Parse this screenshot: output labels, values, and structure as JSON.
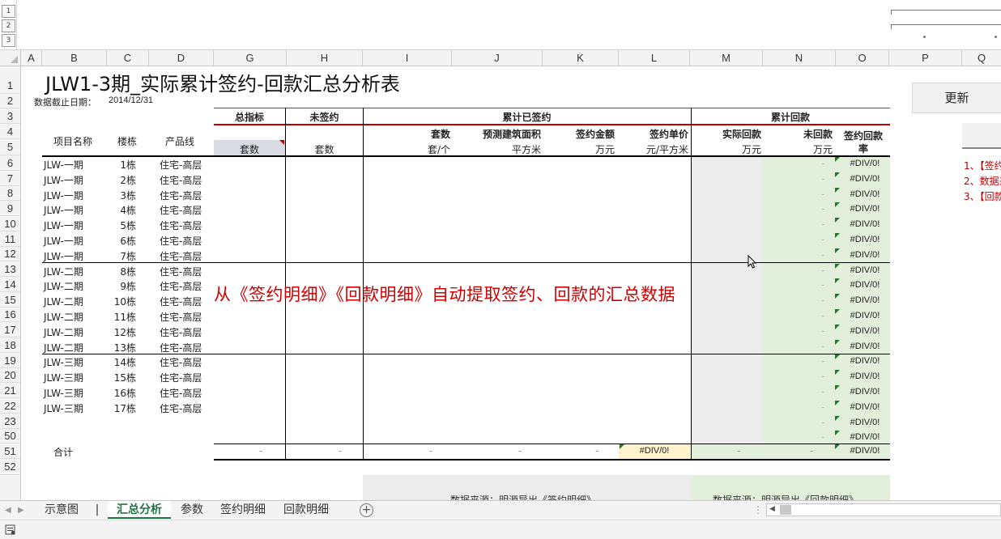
{
  "outline_levels": [
    "1",
    "2",
    "3"
  ],
  "columns": [
    "A",
    "B",
    "C",
    "D",
    "G",
    "H",
    "I",
    "J",
    "K",
    "L",
    "M",
    "N",
    "O",
    "P",
    "Q"
  ],
  "rows": [
    "1",
    "2",
    "3",
    "4",
    "5",
    "6",
    "7",
    "8",
    "9",
    "10",
    "11",
    "12",
    "13",
    "14",
    "15",
    "16",
    "17",
    "18",
    "19",
    "20",
    "21",
    "22",
    "23",
    "50",
    "51",
    "52"
  ],
  "sheet": {
    "title": "JLW1-3期_实际累计签约-回款汇总分析表",
    "date_label": "数据截止日期：",
    "date_value": "2014/12/31",
    "group_total_target": "总指标",
    "group_unsigned": "未签约",
    "group_signed": "累计已签约",
    "group_payment": "累计回款",
    "h_project": "项目名称",
    "h_building": "楼栋",
    "h_product": "产品线",
    "h_sets_g": "套数",
    "h_sets_h": "套数",
    "h_sets_i": "套数",
    "h_sets_i_unit": "套/个",
    "h_area": "预测建筑面积",
    "h_area_unit": "平方米",
    "h_amount": "签约金额",
    "h_amount_unit": "万元",
    "h_price": "签约单价",
    "h_price_unit": "元/平方米",
    "h_actual_pay": "实际回款",
    "h_actual_pay_unit": "万元",
    "h_unpaid": "未回款",
    "h_unpaid_unit": "万元",
    "h_rate_1": "签约回款",
    "h_rate_2": "率",
    "total_label": "合计",
    "total_price": "#DIV/0!",
    "total_rate": "#DIV/0!",
    "dash": "-",
    "overlay_text": "从《签约明细》《回款明细》自动提取签约、回款的汇总数据",
    "bottom_left_note": "数据来源：明源导出《签约明细》",
    "bottom_right_note": "数据来源：明源导出《回款明细》",
    "data_rows": [
      {
        "project": "JLW-一期",
        "building": "1栋",
        "product": "住宅-高层",
        "rate": "#DIV/0!"
      },
      {
        "project": "JLW-一期",
        "building": "2栋",
        "product": "住宅-高层",
        "rate": "#DIV/0!"
      },
      {
        "project": "JLW-一期",
        "building": "3栋",
        "product": "住宅-高层",
        "rate": "#DIV/0!"
      },
      {
        "project": "JLW-一期",
        "building": "4栋",
        "product": "住宅-高层",
        "rate": "#DIV/0!"
      },
      {
        "project": "JLW-一期",
        "building": "5栋",
        "product": "住宅-高层",
        "rate": "#DIV/0!"
      },
      {
        "project": "JLW-一期",
        "building": "6栋",
        "product": "住宅-高层",
        "rate": "#DIV/0!"
      },
      {
        "project": "JLW-一期",
        "building": "7栋",
        "product": "住宅-高层",
        "rate": "#DIV/0!"
      },
      {
        "project": "JLW-二期",
        "building": "8栋",
        "product": "住宅-高层",
        "rate": "#DIV/0!"
      },
      {
        "project": "JLW-二期",
        "building": "9栋",
        "product": "住宅-高层",
        "rate": "#DIV/0!"
      },
      {
        "project": "JLW-二期",
        "building": "10栋",
        "product": "住宅-高层",
        "rate": "#DIV/0!"
      },
      {
        "project": "JLW-二期",
        "building": "11栋",
        "product": "住宅-高层",
        "rate": "#DIV/0!"
      },
      {
        "project": "JLW-二期",
        "building": "12栋",
        "product": "住宅-高层",
        "rate": "#DIV/0!"
      },
      {
        "project": "JLW-二期",
        "building": "13栋",
        "product": "住宅-高层",
        "rate": "#DIV/0!"
      },
      {
        "project": "JLW-三期",
        "building": "14栋",
        "product": "住宅-高层",
        "rate": "#DIV/0!"
      },
      {
        "project": "JLW-三期",
        "building": "15栋",
        "product": "住宅-高层",
        "rate": "#DIV/0!"
      },
      {
        "project": "JLW-三期",
        "building": "16栋",
        "product": "住宅-高层",
        "rate": "#DIV/0!"
      },
      {
        "project": "JLW-三期",
        "building": "17栋",
        "product": "住宅-高层",
        "rate": "#DIV/0!"
      },
      {
        "project": "",
        "building": "",
        "product": "",
        "rate": "#DIV/0!"
      },
      {
        "project": "",
        "building": "",
        "product": "",
        "rate": "#DIV/0!"
      }
    ]
  },
  "side_panel": {
    "update_button": "更新",
    "notes": [
      "1、【签约",
      "2、数据来",
      "3、【回款"
    ]
  },
  "tabs": [
    "示意图",
    "|",
    "汇总分析",
    "参数",
    "签约明细",
    "回款明细"
  ],
  "active_tab": "汇总分析",
  "colors": {
    "accent_red": "#c00000",
    "green_fill": "#e2efda",
    "gray_fill": "#ececec",
    "yellow_fill": "#fff2cc",
    "tab_active": "#217346"
  }
}
